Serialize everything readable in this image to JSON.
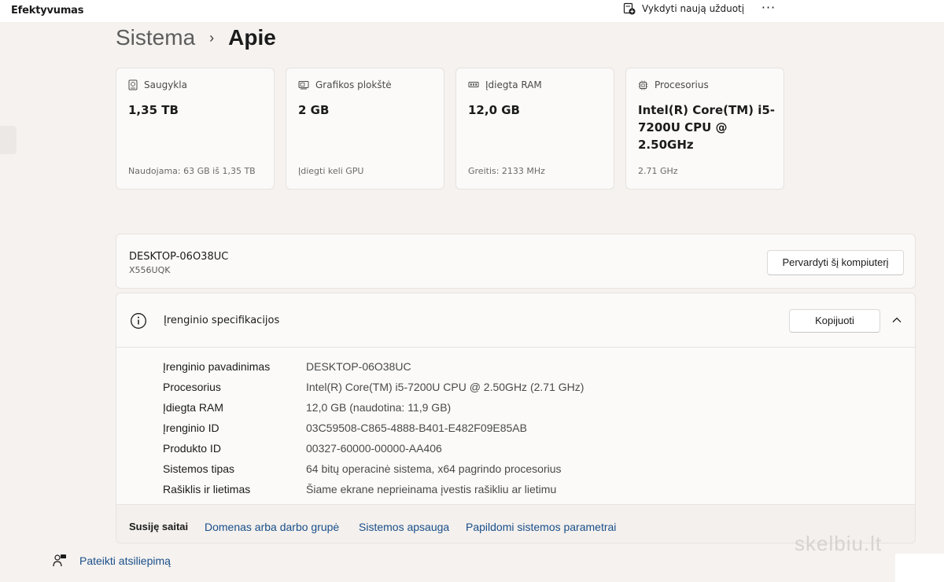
{
  "window": {
    "app_title": "Efektyvumas"
  },
  "toolbar": {
    "run_task_label": "Vykdyti naują užduotį",
    "more_label": "···"
  },
  "breadcrumb": {
    "parent": "Sistema",
    "separator": "›",
    "current": "Apie"
  },
  "cards": [
    {
      "icon": "storage-icon",
      "title": "Saugykla",
      "value": "1,35 TB",
      "sub": "Naudojama: 63 GB iš 1,35 TB"
    },
    {
      "icon": "gpu-icon",
      "title": "Grafikos plokštė",
      "value": "2 GB",
      "sub": "Įdiegti keli GPU"
    },
    {
      "icon": "ram-icon",
      "title": "Įdiegta RAM",
      "value": "12,0 GB",
      "sub": "Greitis: 2133 MHz"
    },
    {
      "icon": "processor-icon",
      "title": "Procesorius",
      "value": "Intel(R) Core(TM) i5-7200U CPU @ 2.50GHz",
      "sub": "2.71 GHz"
    }
  ],
  "device": {
    "name": "DESKTOP-06O38UC",
    "model": "X556UQK",
    "rename_label": "Pervardyti šį kompiuterį"
  },
  "specs": {
    "title": "Įrenginio specifikacijos",
    "copy_label": "Kopijuoti",
    "rows": [
      {
        "label": "Įrenginio pavadinimas",
        "value": "DESKTOP-06O38UC"
      },
      {
        "label": "Procesorius",
        "value": "Intel(R) Core(TM) i5-7200U CPU @ 2.50GHz (2.71 GHz)"
      },
      {
        "label": "Įdiegta RAM",
        "value": "12,0 GB (naudotina: 11,9 GB)"
      },
      {
        "label": "Įrenginio ID",
        "value": "03C59508-C865-4888-B401-E482F09E85AB"
      },
      {
        "label": "Produkto ID",
        "value": "00327-60000-00000-AA406"
      },
      {
        "label": "Sistemos tipas",
        "value": "64 bitų operacinė sistema, x64 pagrindo procesorius"
      },
      {
        "label": "Rašiklis ir lietimas",
        "value": "Šiame ekrane neprieinama įvestis rašikliu ar lietimu"
      }
    ]
  },
  "related": {
    "title": "Susiję saitai",
    "links": [
      "Domenas arba darbo grupė",
      "Sistemos apsauga",
      "Papildomi sistemos parametrai"
    ]
  },
  "feedback": {
    "label": "Pateikti atsiliepimą"
  },
  "watermark": {
    "text": "skelbiu.lt"
  },
  "colors": {
    "background": "#f5f2ef",
    "card": "#fbfaf9",
    "link": "#1a4f8a"
  }
}
